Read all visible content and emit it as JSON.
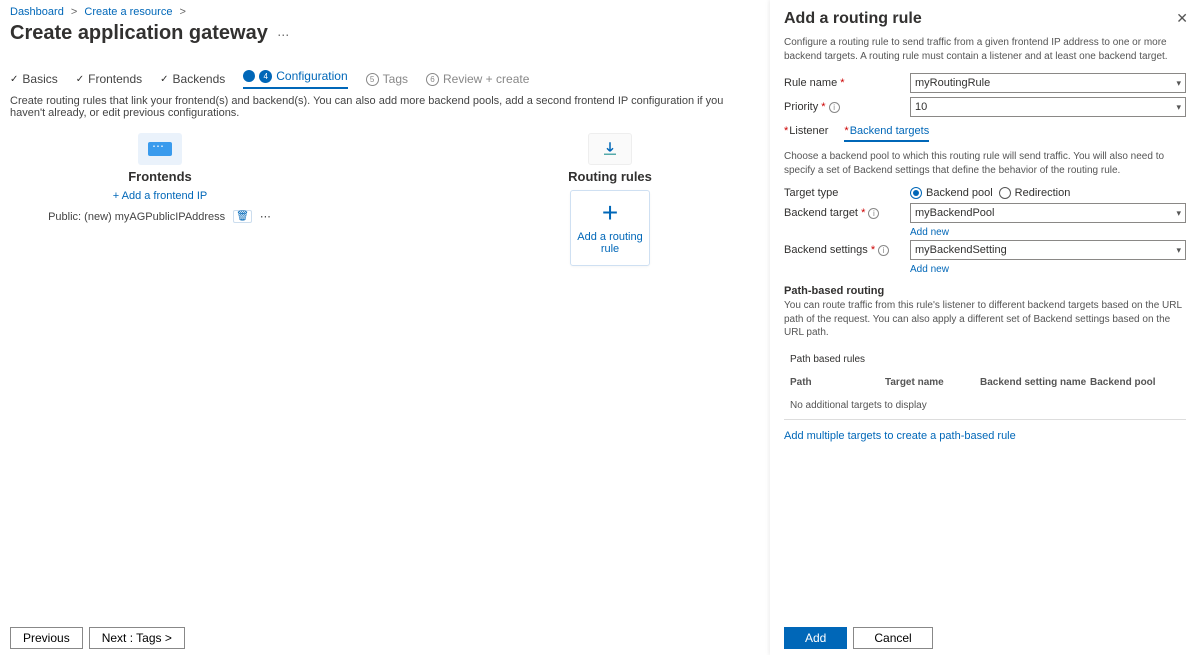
{
  "breadcrumbs": {
    "a": "Dashboard",
    "b": "Create a resource"
  },
  "title": "Create application gateway",
  "steps": {
    "s1": "Basics",
    "s2": "Frontends",
    "s3": "Backends",
    "s4": "Configuration",
    "s5": "Tags",
    "s5num": "5",
    "s6": "Review + create",
    "s6num": "6"
  },
  "desc": "Create routing rules that link your frontend(s) and backend(s). You can also add more backend pools, add a second frontend IP configuration if you haven't already, or edit previous configurations.",
  "frontends": {
    "heading": "Frontends",
    "add": "+ Add a frontend IP",
    "item": "Public: (new) myAGPublicIPAddress"
  },
  "routing": {
    "heading": "Routing rules",
    "add_card": "Add a routing rule"
  },
  "footer": {
    "prev": "Previous",
    "next": "Next : Tags >"
  },
  "panel": {
    "title": "Add a routing rule",
    "intro": "Configure a routing rule to send traffic from a given frontend IP address to one or more backend targets. A routing rule must contain a listener and at least one backend target.",
    "rule_name_lbl": "Rule name",
    "rule_name_val": "myRoutingRule",
    "priority_lbl": "Priority",
    "priority_val": "10",
    "tab_listener": "Listener",
    "tab_backend": "Backend targets",
    "backend_desc": "Choose a backend pool to which this routing rule will send traffic. You will also need to specify a set of Backend settings that define the behavior of the routing rule.",
    "target_type_lbl": "Target type",
    "target_type_a": "Backend pool",
    "target_type_b": "Redirection",
    "backend_target_lbl": "Backend target",
    "backend_target_val": "myBackendPool",
    "backend_settings_lbl": "Backend settings",
    "backend_settings_val": "myBackendSetting",
    "add_new": "Add new",
    "path_heading": "Path-based routing",
    "path_desc": "You can route traffic from this rule's listener to different backend targets based on the URL path of the request. You can also apply a different set of Backend settings based on the URL path.",
    "tbl_cap": "Path based rules",
    "th1": "Path",
    "th2": "Target name",
    "th3": "Backend setting name",
    "th4": "Backend pool",
    "empty": "No additional targets to display",
    "add_multi": "Add multiple targets to create a path-based rule",
    "btn_add": "Add",
    "btn_cancel": "Cancel"
  }
}
